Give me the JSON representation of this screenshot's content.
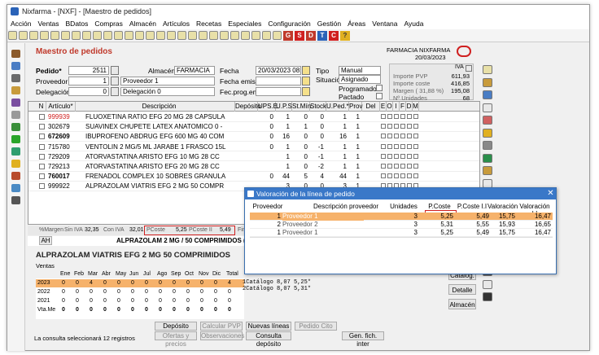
{
  "window": {
    "title": "Nixfarma - [NXF] - [Maestro de pedidos]"
  },
  "menu": [
    "Acción",
    "Ventas",
    "BDatos",
    "Compras",
    "Almacén",
    "Artículos",
    "Recetas",
    "Especiales",
    "Configuración",
    "Gestión",
    "Áreas",
    "Ventana",
    "Ayuda"
  ],
  "toolbar": {
    "letters": [
      "G",
      "S",
      "D",
      "T",
      "C"
    ],
    "help": "?"
  },
  "header": {
    "title": "Maestro de pedidos",
    "pharmacy": "FARMACIA NIXFARMA",
    "date": "20/03/2023",
    "pedido_label": "Pedido*",
    "pedido_value": "2511",
    "proveedor_label": "Proveedor",
    "proveedor_code": "1",
    "proveedor_name": "Proveedor 1",
    "delegacion_label": "Delegación",
    "delegacion_code": "0",
    "delegacion_name": "Delegación 0",
    "almacen_label": "Almacén*",
    "almacen_value": "FARMACIA",
    "fecha_label": "Fecha",
    "fecha_value": "20/03/2023 08:11",
    "fecha_emision_label": "Fecha emisión",
    "fec_prog_label": "Fec.prog.emi.",
    "tipo_label": "Tipo",
    "tipo_value": "Manual",
    "situacion_label": "Situación",
    "situacion_value": "Asignado",
    "programado_label": "Programado",
    "pactado_label": "Pactado",
    "iva_label": "IVA",
    "importe_pvp_label": "Importe PVP",
    "importe_pvp_value": "611,93",
    "importe_coste_label": "Importe coste",
    "importe_coste_value": "416,85",
    "margen_label": "Margen ( 31,88 %)",
    "margen_value": "195,08",
    "unidades_label": "Nº Unidades",
    "unidades_value": "68"
  },
  "grid": {
    "columns": [
      "N",
      "Artículo*",
      "Descripción",
      "Depósito",
      "UPS.E",
      "U.P.S",
      "St.Mín.",
      "Stock",
      "U.Ped.*",
      "Prov",
      "Del",
      "E",
      "O",
      "I",
      "F",
      "D",
      "M"
    ],
    "rows": [
      {
        "code": "999939",
        "desc": "FLUOXETINA RATIO EFG 20 MG 28 CAPSULA",
        "ups": "0",
        "upsv": "1",
        "stmin": "0",
        "stock": "0",
        "uped": "1",
        "prov": "1",
        "code_red": true
      },
      {
        "code": "302679",
        "desc": "SUAVINEX CHUPETE LATEX ANATOMICO 0 -",
        "ups": "0",
        "upsv": "1",
        "stmin": "1",
        "stock": "0",
        "uped": "1",
        "prov": "1"
      },
      {
        "code": "672609",
        "desc": "IBUPROFENO ABDRUG EFG 600 MG 40 COM",
        "ups": "0",
        "upsv": "16",
        "stmin": "0",
        "stock": "0",
        "uped": "16",
        "prov": "1",
        "bold": true
      },
      {
        "code": "715780",
        "desc": "VENTOLIN 2 MG/5 ML JARABE 1 FRASCO 15L",
        "ups": "0",
        "upsv": "1",
        "stmin": "0",
        "stock": "-1",
        "uped": "1",
        "prov": "1"
      },
      {
        "code": "729209",
        "desc": "ATORVASTATINA ARISTO EFG 10 MG 28 CC",
        "ups": "",
        "upsv": "1",
        "stmin": "0",
        "stock": "-1",
        "uped": "1",
        "prov": "1"
      },
      {
        "code": "729213",
        "desc": "ATORVASTATINA ARISTO EFG 20 MG 28 CC",
        "ups": "",
        "upsv": "1",
        "stmin": "0",
        "stock": "-2",
        "uped": "1",
        "prov": "1"
      },
      {
        "code": "760017",
        "desc": "FRENADOL COMPLEX 10 SOBRES GRANULA",
        "ups": "0",
        "upsv": "44",
        "stmin": "5",
        "stock": "4",
        "uped": "44",
        "prov": "1",
        "bold": true
      },
      {
        "code": "999922",
        "desc": "ALPRAZOLAM VIATRIS EFG 2 MG 50 COMPR",
        "ups": "",
        "upsv": "3",
        "stmin": "0",
        "stock": "0",
        "uped": "3",
        "prov": "1"
      }
    ]
  },
  "footer_bar": {
    "margen_label": "%Margen",
    "sin_iva_label": "Sin IVA",
    "sin_iva": "32,35",
    "con_iva_label": "Con IVA",
    "con_iva": "32,01",
    "pcoste_label": "PCoste",
    "pcoste": "5,25",
    "pcoste_ii_label": "PCoste II",
    "pcoste_ii": "5,49",
    "fin_label": "Fin",
    "desc_strip": "ALPRAZOLAM 2 MG / 50 COMPRIMIDOS (630"
  },
  "ah_label": "AH",
  "detail": {
    "title": "ALPRAZOLAM VIATRIS EFG 2 MG 50 COMPRIMIDOS",
    "ventas_label": "Ventas",
    "months": [
      "Ene",
      "Feb",
      "Mar",
      "Abr",
      "May",
      "Jun",
      "Jul",
      "Ago",
      "Sep",
      "Oct",
      "Nov",
      "Dic",
      "Total"
    ],
    "years": [
      {
        "year": "2023",
        "vals": [
          "0",
          "0",
          "4",
          "0",
          "0",
          "0",
          "0",
          "0",
          "0",
          "0",
          "0",
          "0",
          "4"
        ]
      },
      {
        "year": "2022",
        "vals": [
          "0",
          "0",
          "0",
          "0",
          "0",
          "0",
          "0",
          "0",
          "0",
          "0",
          "0",
          "0",
          "0"
        ]
      },
      {
        "year": "2021",
        "vals": [
          "0",
          "0",
          "0",
          "0",
          "0",
          "0",
          "0",
          "0",
          "0",
          "0",
          "0",
          "0",
          "0"
        ]
      },
      {
        "year": "Vta.Me",
        "vals": [
          "0",
          "0",
          "0",
          "0",
          "0",
          "0",
          "0",
          "0",
          "0",
          "0",
          "0",
          "0",
          "0"
        ]
      }
    ],
    "catalog_lines": [
      "1Catálogo  8,07    5,25*",
      "2Catálogo  8,07    5,31*"
    ]
  },
  "dialog": {
    "title": "Valoración de la línea de pedido",
    "columns": [
      "Proveedor",
      "Descripción proveedor",
      "Unidades",
      "P.Coste",
      "P.Coste I.I",
      "Valoración",
      "Valoración I.I"
    ],
    "rows": [
      {
        "num": "1",
        "name": "Proveedor 1",
        "units": "3",
        "pcoste": "5,25",
        "pcoste_ii": "5,49",
        "val": "15,75",
        "val_ii": "16,47"
      },
      {
        "num": "2",
        "name": "Proveedor 2",
        "units": "3",
        "pcoste": "5,31",
        "pcoste_ii": "5,55",
        "val": "15,93",
        "val_ii": "16,65"
      },
      {
        "num": "1",
        "name": "Proveedor 1",
        "units": "3",
        "pcoste": "5,25",
        "pcoste_ii": "5,49",
        "val": "15,75",
        "val_ii": "16,47"
      }
    ]
  },
  "side_buttons": [
    "Catálog.",
    "Detalle",
    "Almacén"
  ],
  "bottom_buttons": {
    "row1": [
      "Depósito",
      "Calcular PVP",
      "Nuevas líneas",
      "Pedido Cito"
    ],
    "row2": [
      "Ofertas y precios",
      "Observaciones",
      "Consulta depósito",
      "Gen. fich. inter"
    ]
  },
  "status": "La consulta seleccionará 12  registros",
  "colors": {
    "accent_red": "#d02020",
    "title_blue": "#3a78c8",
    "highlight_orange": "#f6b26b"
  }
}
